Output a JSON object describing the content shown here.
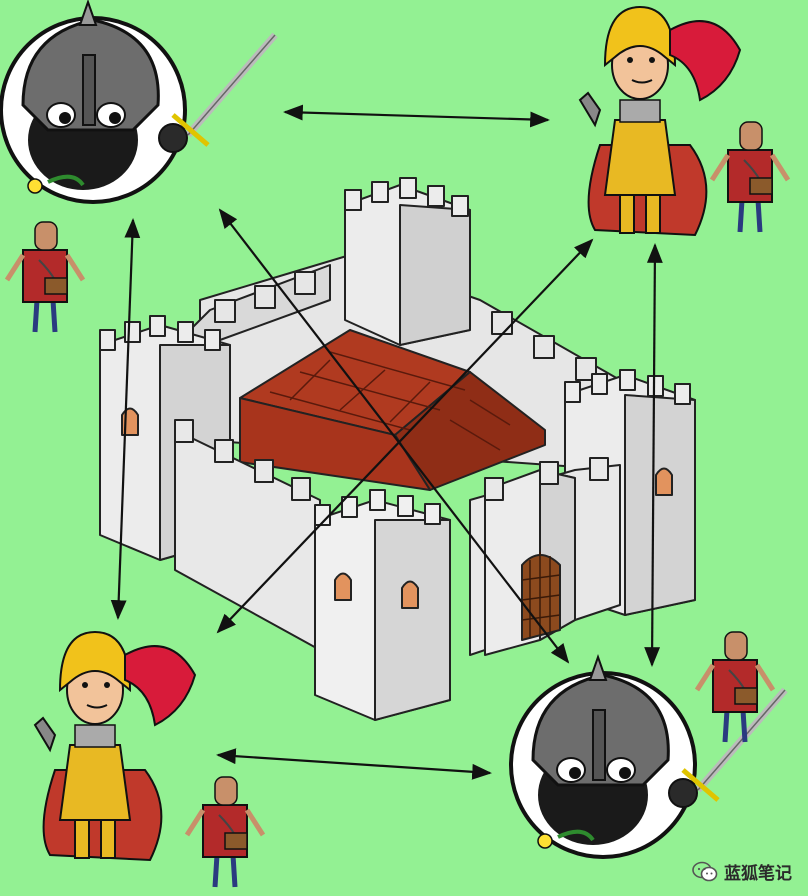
{
  "background_color": "#93f193",
  "castle": {
    "wall_color": "#e6e6e6",
    "shadow_color": "#c7c7c7",
    "roof_color": "#a8341c",
    "window_color": "#e2935e",
    "gate_color": "#8c4a1e"
  },
  "figures": [
    {
      "id": "top-left",
      "type": "sheep-knight",
      "messenger": true
    },
    {
      "id": "top-right",
      "type": "golden-knight",
      "messenger": true
    },
    {
      "id": "bottom-left",
      "type": "golden-knight",
      "messenger": true
    },
    {
      "id": "bottom-right",
      "type": "sheep-knight",
      "messenger": true
    }
  ],
  "connections": [
    {
      "from": "top-left",
      "to": "top-right"
    },
    {
      "from": "top-left",
      "to": "bottom-left"
    },
    {
      "from": "top-left",
      "to": "bottom-right"
    },
    {
      "from": "top-right",
      "to": "bottom-left"
    },
    {
      "from": "top-right",
      "to": "bottom-right"
    },
    {
      "from": "bottom-left",
      "to": "bottom-right"
    }
  ],
  "watermark": {
    "text": "蓝狐笔记",
    "icon": "wechat-icon"
  }
}
